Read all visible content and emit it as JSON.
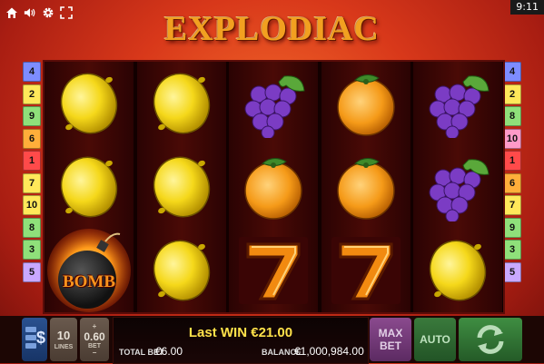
{
  "clock": "9:11",
  "logo_text": "EXPLODIAC",
  "top_icons": [
    "home-icon",
    "speaker-icon",
    "gear-icon",
    "fullscreen-icon"
  ],
  "lines_left": [
    "4",
    "2",
    "9",
    "6",
    "1",
    "7",
    "10",
    "8",
    "3",
    "5"
  ],
  "lines_right": [
    "4",
    "2",
    "8",
    "10",
    "1",
    "6",
    "7",
    "9",
    "3",
    "5"
  ],
  "line_colors_left": [
    "#7d8cff",
    "#ffe85a",
    "#8fe07a",
    "#ffae3a",
    "#ff4a4a",
    "#ffe85a",
    "#ffe85a",
    "#8fe07a",
    "#8fe07a",
    "#c9a8ff"
  ],
  "line_colors_right": [
    "#7d8cff",
    "#ffe85a",
    "#8fe07a",
    "#ff9ac8",
    "#ff4a4a",
    "#ffae3a",
    "#ffe85a",
    "#8fe07a",
    "#8fe07a",
    "#c9a8ff"
  ],
  "reels": [
    [
      "lemon",
      "lemon",
      "bomb"
    ],
    [
      "lemon",
      "lemon",
      "lemon"
    ],
    [
      "grapes",
      "orange",
      "seven"
    ],
    [
      "orange",
      "orange",
      "seven"
    ],
    [
      "grapes",
      "grapes",
      "lemon"
    ]
  ],
  "bomb_label": "BOMB",
  "seven_label": "7",
  "controls": {
    "currency_icon": "$",
    "lines_value": "10",
    "lines_label": "LINES",
    "bet_value": "0.60",
    "bet_label": "BET",
    "last_win": "Last WIN €21.00",
    "total_bet_label": "TOTAL BET",
    "total_bet_value": "€6.00",
    "balance_label": "BALANCE",
    "balance_value": "€1,000,984.00",
    "max_bet_label_1": "MAX",
    "max_bet_label_2": "BET",
    "auto_label": "AUTO"
  }
}
